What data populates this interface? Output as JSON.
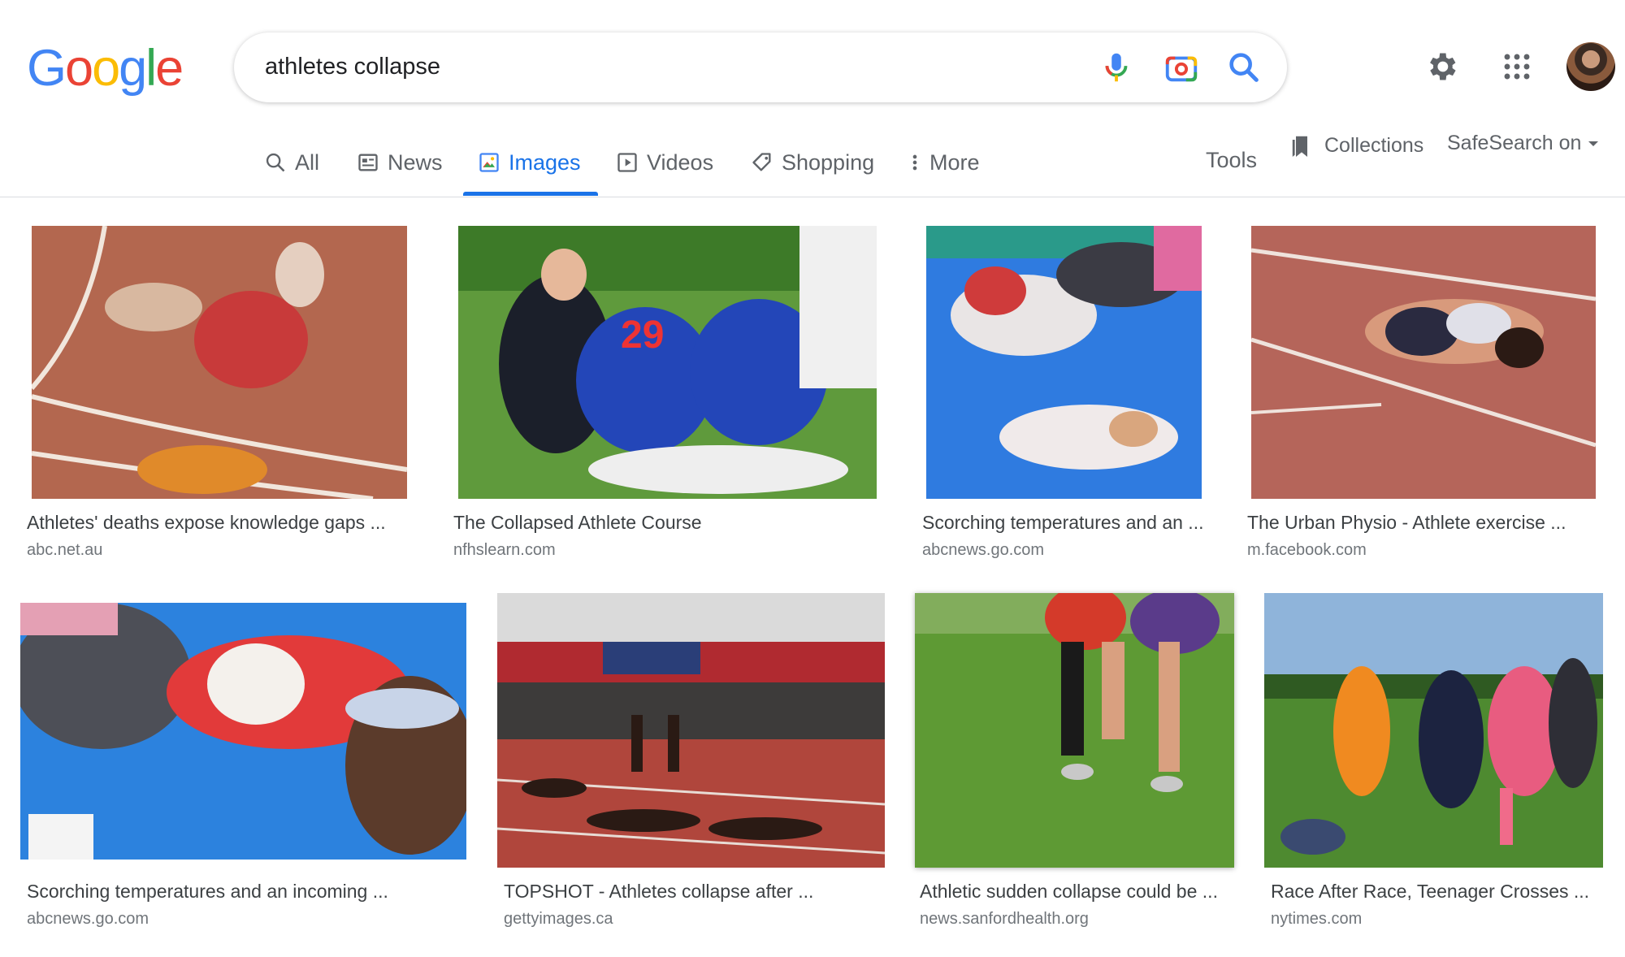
{
  "logo": {
    "letters": [
      "G",
      "o",
      "o",
      "g",
      "l",
      "e"
    ],
    "colors": [
      "#4285F4",
      "#EA4335",
      "#FBBC05",
      "#4285F4",
      "#34A853",
      "#EA4335"
    ]
  },
  "search": {
    "query": "athletes collapse",
    "icons": [
      "mic-icon",
      "camera-icon",
      "search-icon"
    ]
  },
  "header_icons": [
    "gear-icon",
    "apps-grid-icon",
    "avatar"
  ],
  "tabs": [
    {
      "label": "All",
      "icon": "search-icon"
    },
    {
      "label": "News",
      "icon": "news-icon"
    },
    {
      "label": "Images",
      "icon": "image-icon",
      "active": true
    },
    {
      "label": "Videos",
      "icon": "play-icon"
    },
    {
      "label": "Shopping",
      "icon": "tag-icon"
    },
    {
      "label": "More",
      "icon": "more-vert-icon"
    }
  ],
  "tools_label": "Tools",
  "collections_label": "Collections",
  "safesearch_label": "SafeSearch on",
  "accent_color": "#1a73e8",
  "results": [
    {
      "caption": "Athletes' deaths expose knowledge gaps ...",
      "source": "abc.net.au"
    },
    {
      "caption": "The Collapsed Athlete Course",
      "source": "nfhslearn.com"
    },
    {
      "caption": "Scorching temperatures and an ...",
      "source": "abcnews.go.com"
    },
    {
      "caption": "The Urban Physio - Athlete exercise ...",
      "source": "m.facebook.com"
    },
    {
      "caption": "Scorching temperatures and an incoming ...",
      "source": "abcnews.go.com"
    },
    {
      "caption": "TOPSHOT - Athletes collapse after ...",
      "source": "gettyimages.ca"
    },
    {
      "caption": "Athletic sudden collapse could be ...",
      "source": "news.sanfordhealth.org"
    },
    {
      "caption": "Race After Race, Teenager Crosses ...",
      "source": "nytimes.com"
    }
  ]
}
